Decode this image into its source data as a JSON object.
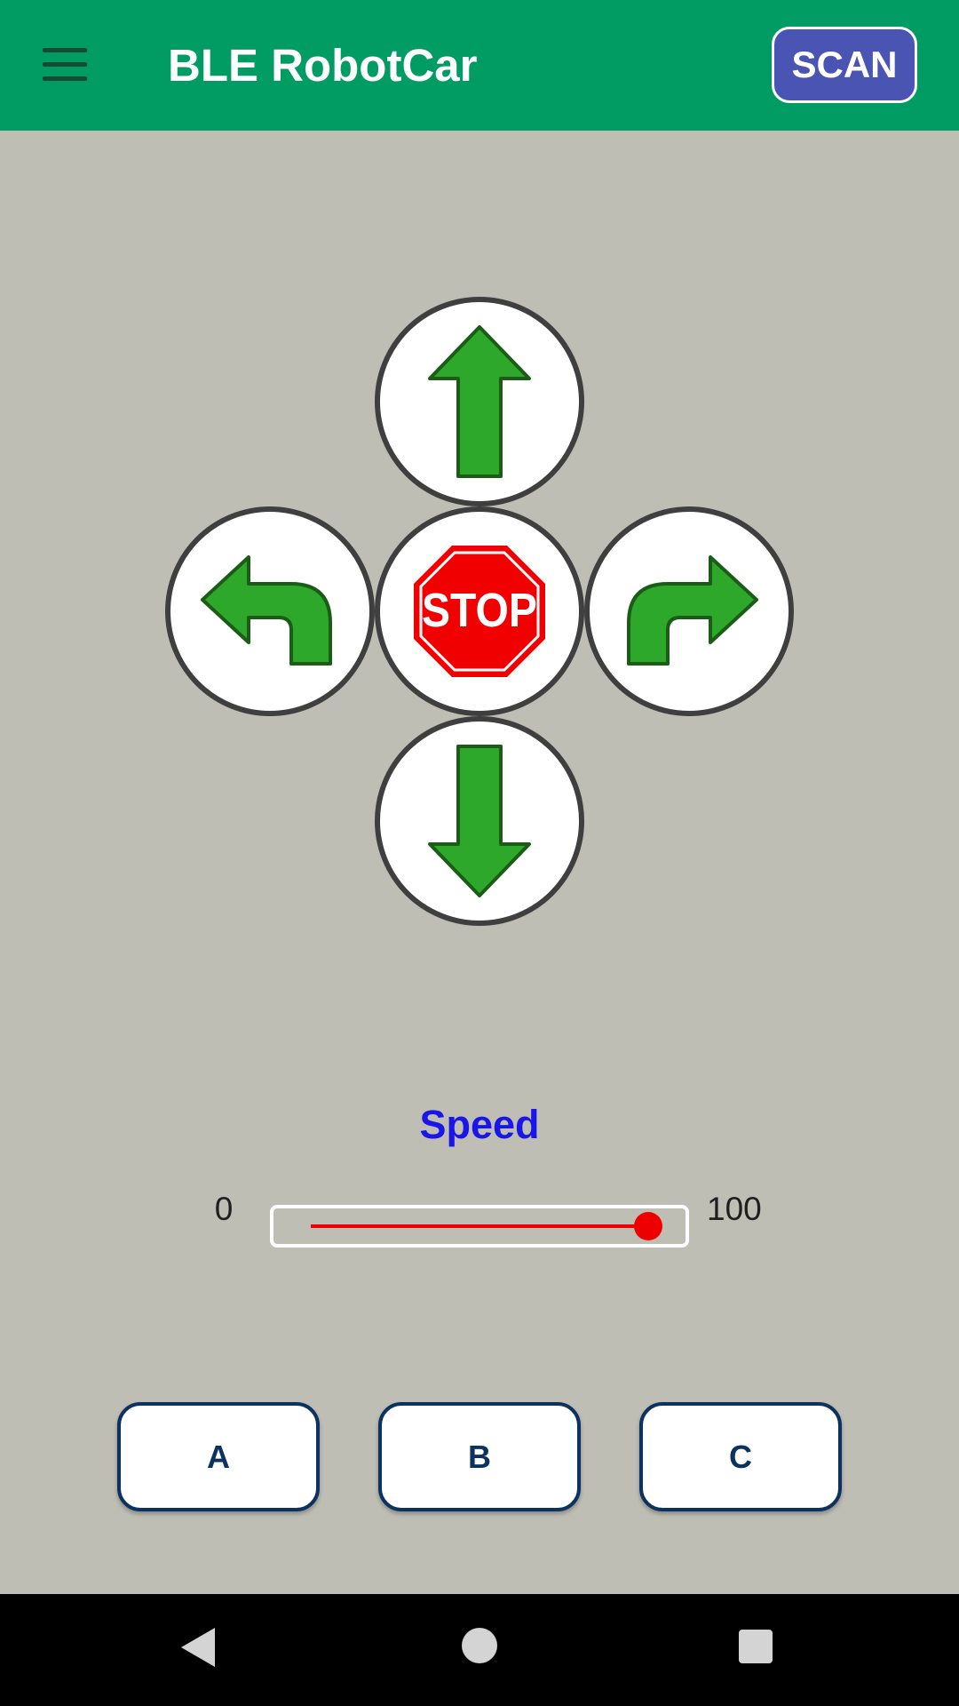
{
  "app_bar": {
    "title": "BLE RobotCar",
    "scan_label": "SCAN",
    "menu_icon": "hamburger-menu-icon",
    "background_color": "#009c63"
  },
  "direction_pad": {
    "forward_icon": "arrow-up-icon",
    "left_icon": "turn-left-arrow-icon",
    "stop_label": "STOP",
    "right_icon": "turn-right-arrow-icon",
    "backward_icon": "arrow-down-icon",
    "arrow_color": "#2ea82a",
    "stop_color": "#f00000"
  },
  "speed": {
    "label": "Speed",
    "min_label": "0",
    "max_label": "100",
    "value": 100,
    "min": 0,
    "max": 100,
    "accent_color": "#ef0000"
  },
  "action_buttons": [
    "A",
    "B",
    "C"
  ],
  "system_nav": {
    "back_icon": "back-triangle-icon",
    "home_icon": "home-circle-icon",
    "recents_icon": "recents-square-icon"
  }
}
